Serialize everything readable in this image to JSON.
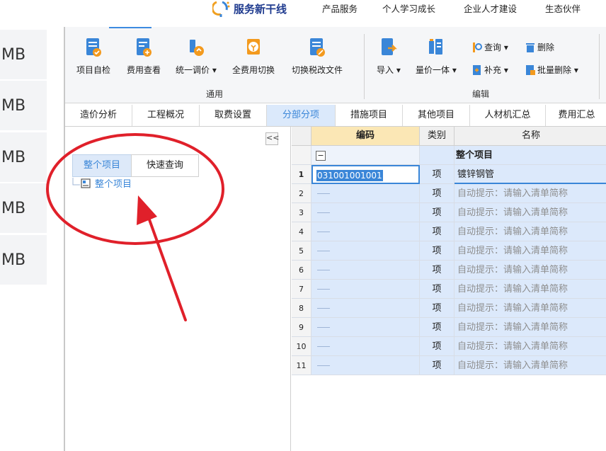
{
  "topnav": {
    "brand": "服务新干线",
    "items": [
      "产品服务",
      "个人学习成长",
      "企业人才建设",
      "生态伙伴"
    ]
  },
  "left_strip": {
    "items": [
      "MB",
      "MB",
      "MB",
      "MB",
      "MB"
    ]
  },
  "ribbon": {
    "buttons": [
      "项目自检",
      "费用查看",
      "统一调价",
      "全费用切换",
      "切换税改文件",
      "导入",
      "量价一体"
    ],
    "small": {
      "query": "查询",
      "delete": "删除",
      "supplement": "补充",
      "batch_delete": "批量删除"
    },
    "groups": {
      "general": "通用",
      "edit": "编辑"
    }
  },
  "tabs": [
    "造价分析",
    "工程概况",
    "取费设置",
    "分部分项",
    "措施项目",
    "其他项目",
    "人材机汇总",
    "费用汇总"
  ],
  "left_pane": {
    "collapse": "<<",
    "subtabs": [
      "整个项目",
      "快速查询"
    ],
    "tree_root": "整个项目"
  },
  "grid": {
    "headers": {
      "code": "编码",
      "type": "类别",
      "name": "名称"
    },
    "group_row": {
      "toggle": "−",
      "name": "整个项目"
    },
    "rows": [
      {
        "num": "1",
        "code": "031001001001",
        "type": "项",
        "name": "镀锌钢管"
      },
      {
        "num": "2",
        "code": "",
        "type": "项",
        "name": "自动提示：请输入清单简称"
      },
      {
        "num": "3",
        "code": "",
        "type": "项",
        "name": "自动提示：请输入清单简称"
      },
      {
        "num": "4",
        "code": "",
        "type": "项",
        "name": "自动提示：请输入清单简称"
      },
      {
        "num": "5",
        "code": "",
        "type": "项",
        "name": "自动提示：请输入清单简称"
      },
      {
        "num": "6",
        "code": "",
        "type": "项",
        "name": "自动提示：请输入清单简称"
      },
      {
        "num": "7",
        "code": "",
        "type": "项",
        "name": "自动提示：请输入清单简称"
      },
      {
        "num": "8",
        "code": "",
        "type": "项",
        "name": "自动提示：请输入清单简称"
      },
      {
        "num": "9",
        "code": "",
        "type": "项",
        "name": "自动提示：请输入清单简称"
      },
      {
        "num": "10",
        "code": "",
        "type": "项",
        "name": "自动提示：请输入清单简称"
      },
      {
        "num": "11",
        "code": "",
        "type": "项",
        "name": "自动提示：请输入清单简称"
      }
    ]
  },
  "colors": {
    "accent": "#3a86d8",
    "annotation": "#e0202a",
    "header_highlight": "#fbe7b5",
    "selected_row": "#dce9fb"
  }
}
